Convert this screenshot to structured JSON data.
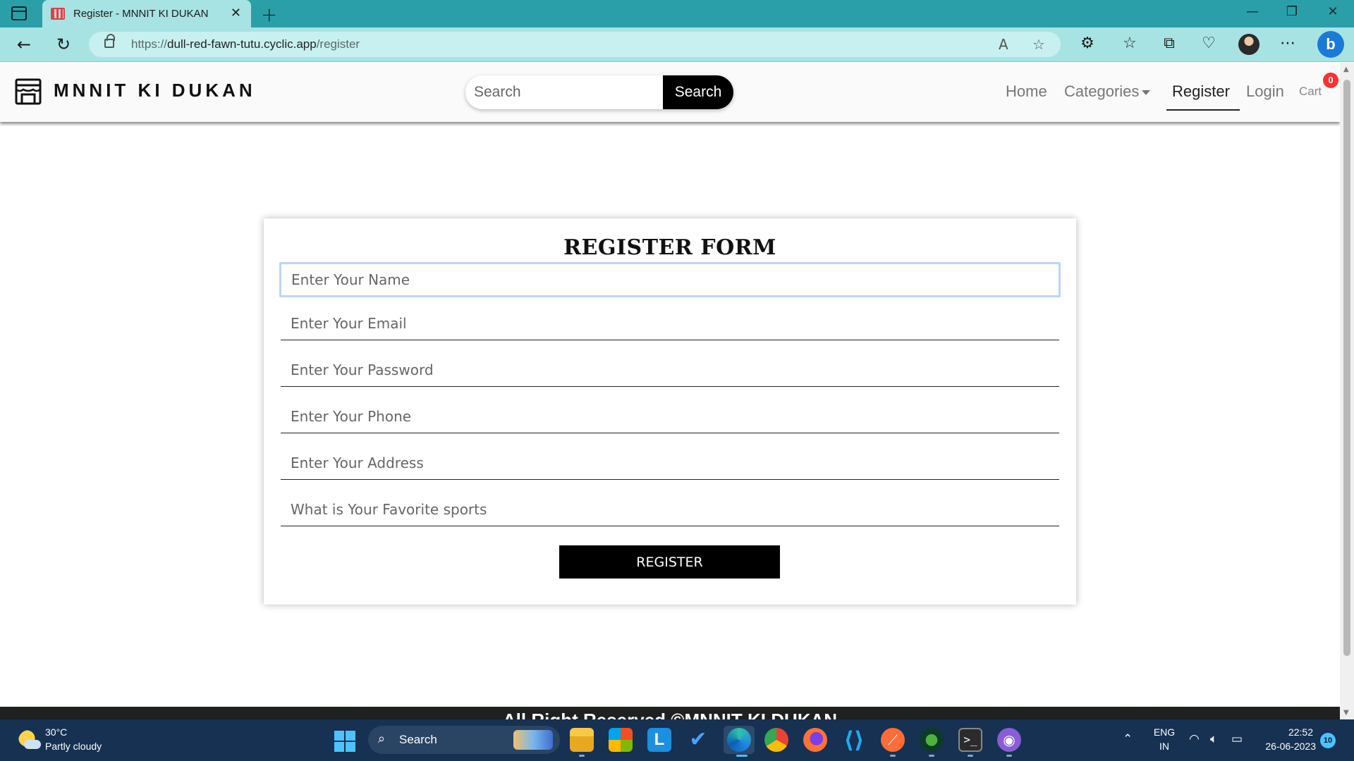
{
  "browser": {
    "tab_title": "Register - MNNIT KI DUKAN",
    "url_prefix": "https://",
    "url_domain": "dull-red-fawn-tutu.cyclic.app",
    "url_path": "/register"
  },
  "site": {
    "brand": "MNNIT KI DUKAN",
    "search": {
      "placeholder": "Search",
      "button_label": "Search"
    },
    "nav": {
      "home": "Home",
      "categories": "Categories",
      "register": "Register",
      "login": "Login",
      "cart": "Cart",
      "cart_count": "0"
    }
  },
  "form": {
    "title": "REGISTER FORM",
    "fields": [
      {
        "placeholder": "Enter Your Name"
      },
      {
        "placeholder": "Enter Your Email"
      },
      {
        "placeholder": "Enter Your Password"
      },
      {
        "placeholder": "Enter Your Phone"
      },
      {
        "placeholder": "Enter Your Address"
      },
      {
        "placeholder": "What is Your Favorite sports"
      }
    ],
    "submit_label": "REGISTER"
  },
  "footer": {
    "text": "All Right Reserved ©MNNIT KI DUKAN"
  },
  "taskbar": {
    "weather_temp": "30°C",
    "weather_cond": "Partly cloudy",
    "search_label": "Search",
    "lang_1": "ENG",
    "lang_2": "IN",
    "time": "22:52",
    "date": "26-06-2023",
    "notifications": "10"
  },
  "colors": {
    "tabbar": "#2b9fa8",
    "addressbar": "#a8e3e3",
    "accent_black": "#000000",
    "cart_badge": "#ff3030",
    "focus_ring": "#b9d6fb",
    "taskbar": "#163152"
  }
}
